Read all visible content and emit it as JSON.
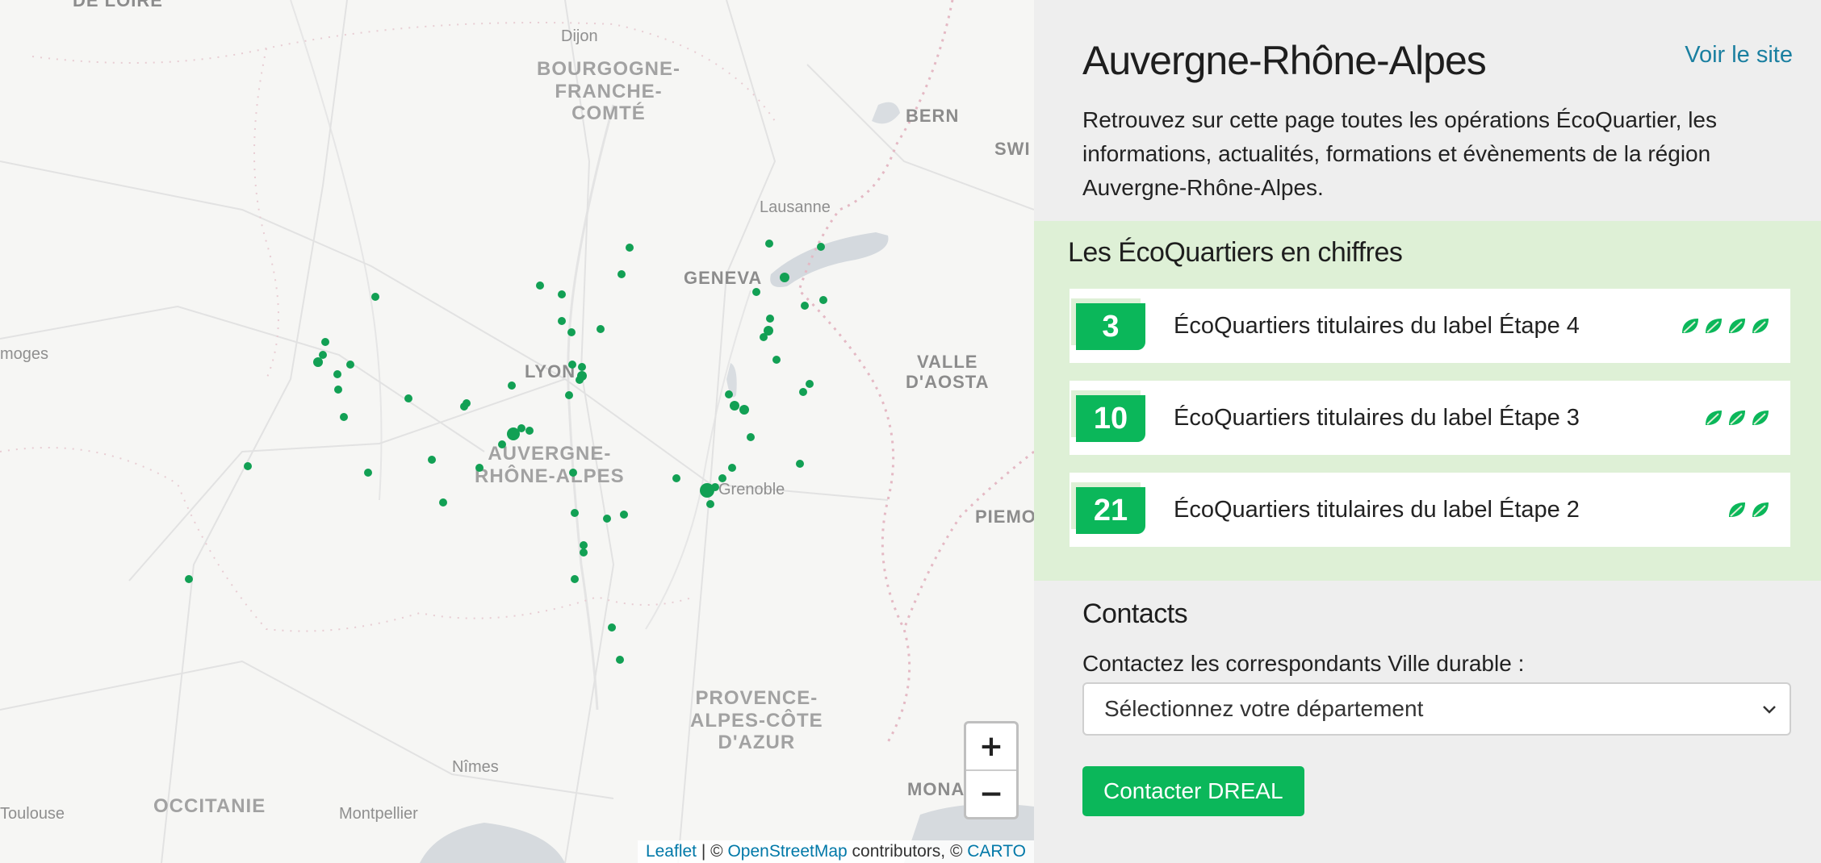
{
  "map": {
    "labels": {
      "de_loire": "DE LOIRE",
      "bourgogne": "BOURGOGNE-\nFRANCHE-\nCOMTÉ",
      "dijon": "Dijon",
      "bern": "BERN",
      "swi": "SWI",
      "lausanne": "Lausanne",
      "geneva": "GENEVA",
      "valle": "VALLE\nD'AOSTA",
      "limoges": "moges",
      "lyon": "LYON",
      "auvergne": "AUVERGNE-\nRHÔNE-ALPES",
      "grenoble": "Grenoble",
      "piemo": "PIEMO",
      "provence": "PROVENCE-\nALPES-CÔTE\nD'AZUR",
      "nimes": "Nîmes",
      "toulouse": "Toulouse",
      "occitanie": "OCCITANIE",
      "montpellier": "Montpellier",
      "mona": "MONA"
    },
    "zoom_in": "+",
    "zoom_out": "−",
    "attribution": {
      "leaflet": "Leaflet",
      "sep1": " | © ",
      "osm": "OpenStreetMap",
      "mid": " contributors, © ",
      "carto": "CARTO"
    },
    "marker_color": "#12a054"
  },
  "panel": {
    "title": "Auvergne-Rhône-Alpes",
    "site_link": "Voir le site",
    "intro": "Retrouvez sur cette page toutes les opérations ÉcoQuartier, les informations, actualités, formations et évènements de la région Auvergne-Rhône-Alpes.",
    "stats_title": "Les ÉcoQuartiers en chiffres",
    "stats": [
      {
        "count": "3",
        "label": "ÉcoQuartiers titulaires du label Étape 4",
        "leaves": 4
      },
      {
        "count": "10",
        "label": "ÉcoQuartiers titulaires du label Étape 3",
        "leaves": 3
      },
      {
        "count": "21",
        "label": "ÉcoQuartiers titulaires du label Étape 2",
        "leaves": 2
      }
    ],
    "contacts_title": "Contacts",
    "contacts_sub": "Contactez les correspondants Ville durable :",
    "select_value": "Sélectionnez votre département",
    "contact_button": "Contacter DREAL",
    "colors": {
      "accent": "#0bb75a",
      "stats_bg": "#def0d6",
      "link": "#1a7fa0"
    }
  }
}
